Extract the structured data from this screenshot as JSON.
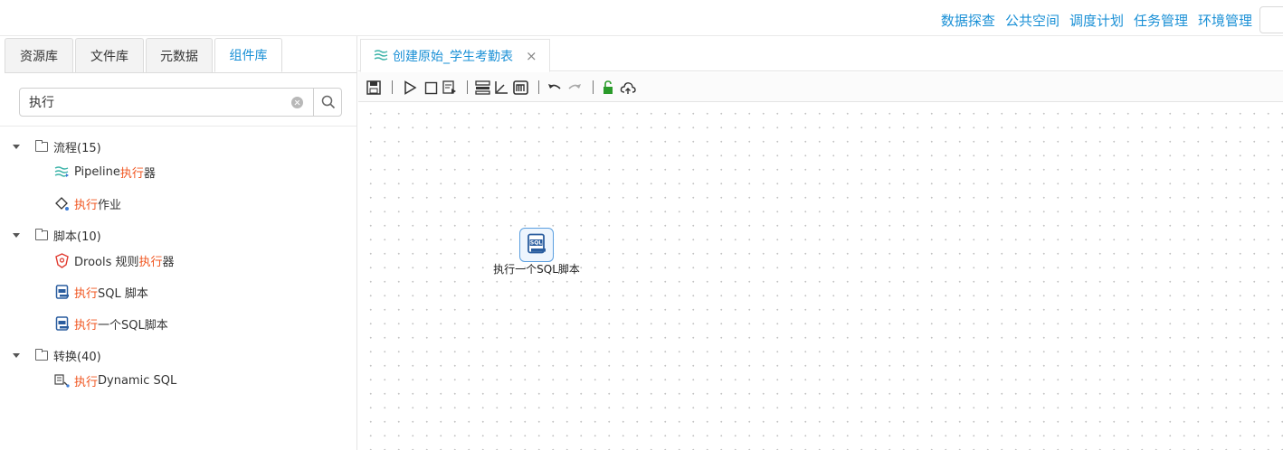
{
  "top_nav": [
    "数据探查",
    "公共空间",
    "调度计划",
    "任务管理",
    "环境管理"
  ],
  "left_tabs": [
    {
      "label": "资源库",
      "active": false
    },
    {
      "label": "文件库",
      "active": false
    },
    {
      "label": "元数据",
      "active": false
    },
    {
      "label": "组件库",
      "active": true
    }
  ],
  "search": {
    "value": "执行",
    "placeholder": ""
  },
  "tree": {
    "groups": [
      {
        "label": "流程(15)",
        "items": [
          {
            "icon": "pipeline-icon",
            "pre": "Pipeline ",
            "hl": "执行",
            "post": " 器"
          },
          {
            "icon": "job-icon",
            "pre": "",
            "hl": "执行",
            "post": " 作业"
          }
        ]
      },
      {
        "label": "脚本(10)",
        "items": [
          {
            "icon": "drools-icon",
            "pre": "Drools 规则 ",
            "hl": "执行",
            "post": " 器"
          },
          {
            "icon": "sql-script-icon",
            "pre": "",
            "hl": "执行",
            "post": " SQL 脚本"
          },
          {
            "icon": "sql-script-icon",
            "pre": "",
            "hl": "执行",
            "post": " 一个SQL脚本"
          }
        ]
      },
      {
        "label": "转换(40)",
        "items": [
          {
            "icon": "dynamic-sql-icon",
            "pre": "",
            "hl": "执行",
            "post": " Dynamic SQL"
          }
        ]
      }
    ]
  },
  "editor_tab": {
    "title": "创建原始_学生考勤表",
    "close": "×"
  },
  "toolbar_icons": [
    "save-icon",
    "run-icon",
    "stop-icon",
    "debug-icon",
    "layout-icon",
    "chart-icon",
    "memory-icon",
    "undo-icon",
    "redo-icon",
    "unlock-icon",
    "upload-cloud-icon"
  ],
  "canvas_node": {
    "label": "执行一个SQL脚本",
    "icon": "sql-script-icon",
    "icon_text": "SQL"
  },
  "colors": {
    "accent": "#1a90d6",
    "highlight": "#f0541e"
  }
}
